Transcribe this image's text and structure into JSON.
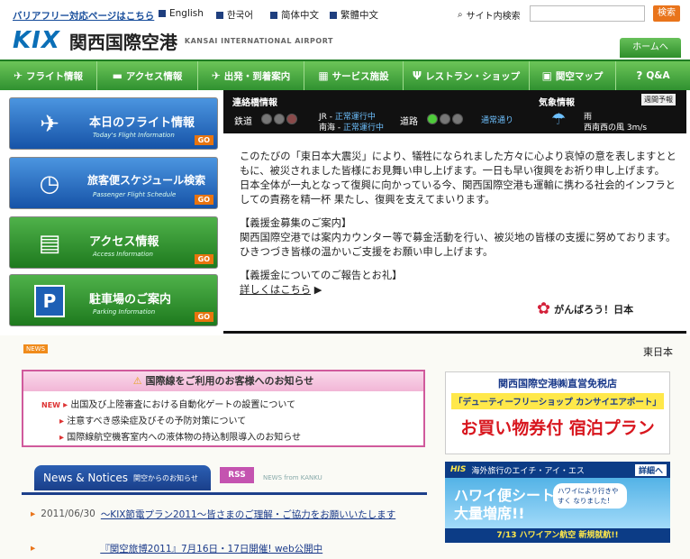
{
  "top": {
    "barrier_free": "バリアフリー対応ページはこちら",
    "languages": [
      "English",
      "한국어",
      "简体中文",
      "繁體中文"
    ],
    "search_label": "サイト内検索",
    "search_button": "検索"
  },
  "logo": {
    "kix": "KIX",
    "jp": "関西国際空港",
    "en": "KANSAI INTERNATIONAL AIRPORT"
  },
  "home_button": "ホームへ",
  "nav": [
    {
      "label": "フライト情報",
      "icon": "airplane-icon",
      "glyph": "✈"
    },
    {
      "label": "アクセス情報",
      "icon": "car-icon",
      "glyph": "🚗"
    },
    {
      "label": "出発・到着案内",
      "icon": "departure-icon",
      "glyph": "✈"
    },
    {
      "label": "サービス施設",
      "icon": "facility-icon",
      "glyph": "▦"
    },
    {
      "label": "レストラン・ショップ",
      "icon": "restaurant-icon",
      "glyph": "🍴"
    },
    {
      "label": "関空マップ",
      "icon": "map-icon",
      "glyph": "▣"
    },
    {
      "label": "Q&A",
      "icon": "question-icon",
      "glyph": "?"
    }
  ],
  "left_buttons": [
    {
      "title": "本日のフライト情報",
      "sub": "Today's Flight Information",
      "go": "GO",
      "icon": "airplane-icon",
      "bg": "#1e6fc4"
    },
    {
      "title": "旅客便スケジュール検索",
      "sub": "Passenger Flight Schedule",
      "go": "GO",
      "icon": "clock-icon",
      "bg": "#1c6cc0"
    },
    {
      "title": "アクセス情報",
      "sub": "Access Information",
      "go": "GO",
      "icon": "train-icon",
      "bg": "#2d8a2a"
    },
    {
      "title": "駐車場のご案内",
      "sub": "Parking Information",
      "go": "GO",
      "icon": "parking-icon",
      "bg": "#2d8a2a"
    }
  ],
  "status": {
    "bridge_title": "連絡橋情報",
    "rail": "鉄道",
    "jr": "JR",
    "jr_status": "正常運行中",
    "nankai": "南海",
    "nankai_status": "正常運行中",
    "road": "道路",
    "road_status": "通常通り",
    "weather_title": "気象情報",
    "weekly": "週間予報",
    "weather": "雨",
    "wind": "西南西の風",
    "wind_speed": "3m/s"
  },
  "message": {
    "p1": "このたびの「東日本大震災」により、犠牲になられました方々に心より哀悼の意を表しますとともに、被災されました皆様にお見舞い申し上げます。一日も早い復興をお祈り申し上げます。",
    "p2": "日本全体が一丸となって復興に向かっている今、関西国際空港も運輸に携わる社会的インフラとしての責務を精一杯 果たし、復興を支えてまいります。",
    "h1": "【義援金募集のご案内】",
    "p3": "関西国際空港では案内カウンター等で募金活動を行い、被災地の皆様の支援に努めております。ひきつづき皆様の温かいご支援をお願い申し上げます。",
    "h2": "【義援金についてのご報告とお礼】",
    "link": "詳しくはこちら",
    "ganbaro": "がんばろう！日本"
  },
  "news_badge": "NEWS",
  "higashi": "東日本",
  "notice": {
    "head": "国際線をご利用のお客様へのお知らせ",
    "items": [
      {
        "new": "NEW",
        "text": "出国及び上陸審査における自動化ゲートの設置について"
      },
      {
        "new": "",
        "text": "注意すべき感染症及びその予防対策について"
      },
      {
        "new": "",
        "text": "国際線航空機客室内への液体物の持込制限導入のお知らせ"
      }
    ]
  },
  "news_tab": {
    "big": "News & Notices",
    "small": "関空からのお知らせ",
    "rss": "RSS",
    "kanku": "NEWS from KANKU"
  },
  "news": [
    {
      "date": "2011/06/30",
      "text": "～KIX節電プラン2011～皆さまのご理解・ご協力をお願いいたします"
    },
    {
      "date": "",
      "text": "『関空旅博2011』7月16日・17日開催! web公開中"
    }
  ],
  "ad1": {
    "line1": "関西国際空港㈱直営免税店",
    "line2": "「デューティーフリーショップ カンサイエアポート」",
    "line3": "お買い物券付 宿泊プラン"
  },
  "ad2": {
    "brand": "HIS",
    "brand_text": "海外旅行のエイチ・アイ・エス",
    "detail": "詳細へ",
    "line1": "ハワイ便シート",
    "line2": "大量増席!!",
    "bubble": "ハワイにより行きやすく なりました!",
    "line3": "7/13 ハワイアン航空 新規就航!!"
  },
  "colors": {
    "green": "#2f9130",
    "blue": "#1e6fc4",
    "orange": "#e9741b",
    "pink": "#d05a9c"
  }
}
